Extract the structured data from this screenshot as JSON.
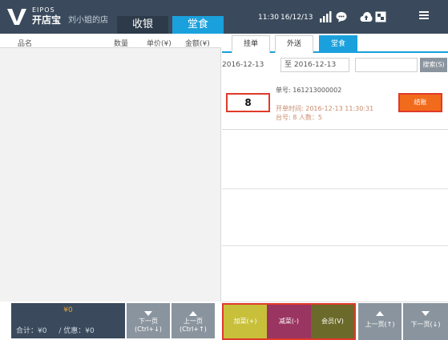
{
  "header": {
    "logo_sub": "EIPOS",
    "logo_name": "开店宝",
    "store_name": "刘小姐的店",
    "tabs": [
      {
        "label": "收银",
        "active": false
      },
      {
        "label": "堂食",
        "active": true
      }
    ],
    "time": "11:30",
    "date": "16/12/13",
    "icons": [
      "signal-icon",
      "chat-icon",
      "cloud-upload-icon",
      "box-icon",
      "menu-icon"
    ]
  },
  "left": {
    "columns": [
      "品名",
      "数量",
      "单价(¥)",
      "金额(¥)"
    ],
    "total_amount": "¥0",
    "total_label": "合计：¥0",
    "discount_label": "/ 优惠：¥0",
    "next_page": {
      "label": "下一页",
      "shortcut": "(Ctrl+↓)"
    },
    "prev_page": {
      "label": "上一页",
      "shortcut": "(Ctrl+↑)"
    }
  },
  "right": {
    "tabs": [
      {
        "label": "挂单",
        "active": false
      },
      {
        "label": "外送",
        "active": false
      },
      {
        "label": "堂食",
        "active": true
      }
    ],
    "date_from": "2016-12-13",
    "date_to": "至 2016-12-13",
    "search_value": "",
    "search_label": "搜索(S)",
    "orders": [
      {
        "table_number": "8",
        "order_no": "单号: 161213000002",
        "open_time": "开单时间: 2016-12-13  11:30:31",
        "table_info": "台号: 8  人数：5",
        "settle_label": "结账"
      }
    ],
    "actions": {
      "add_dish": "加菜(+)",
      "remove_dish": "减菜(-)",
      "member": "会员(V)",
      "prev_page": {
        "label": "上一页(↑)"
      },
      "next_page": {
        "label": "下一页(↓)"
      }
    }
  },
  "colors": {
    "topbar": "#3a4a5c",
    "accent": "#1aa0dc",
    "settle": "#f26b1d",
    "highlight": "#e03a2a",
    "add_dish": "#c8c03a",
    "remove_dish": "#9a3460",
    "member": "#6b6a2a"
  }
}
